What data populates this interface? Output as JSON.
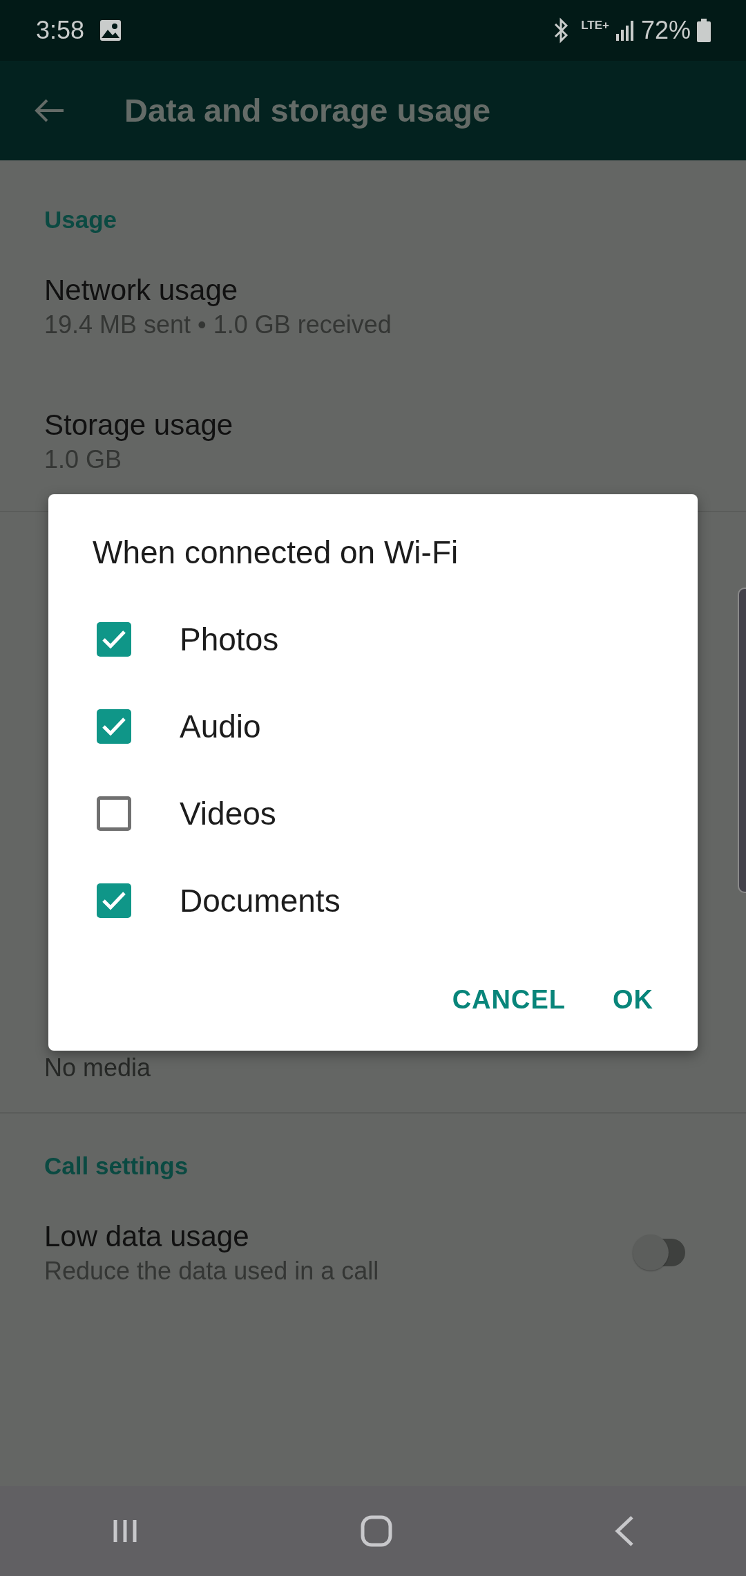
{
  "status_bar": {
    "time": "3:58",
    "network": "LTE+",
    "battery": "72%"
  },
  "app_bar": {
    "title": "Data and storage usage"
  },
  "usage": {
    "header": "Usage",
    "items": [
      {
        "title": "Network usage",
        "subtitle": "19.4 MB sent • 1.0 GB received"
      },
      {
        "title": "Storage usage",
        "subtitle": "1.0 GB"
      }
    ]
  },
  "covered_section": {
    "visible_text": "No media"
  },
  "call_settings": {
    "header": "Call settings",
    "items": [
      {
        "title": "Low data usage",
        "subtitle": "Reduce the data used in a call",
        "on": false
      }
    ]
  },
  "dialog": {
    "title": "When connected on Wi-Fi",
    "options": [
      {
        "label": "Photos",
        "checked": true
      },
      {
        "label": "Audio",
        "checked": true
      },
      {
        "label": "Videos",
        "checked": false
      },
      {
        "label": "Documents",
        "checked": true
      }
    ],
    "buttons": [
      "CANCEL",
      "OK"
    ]
  }
}
